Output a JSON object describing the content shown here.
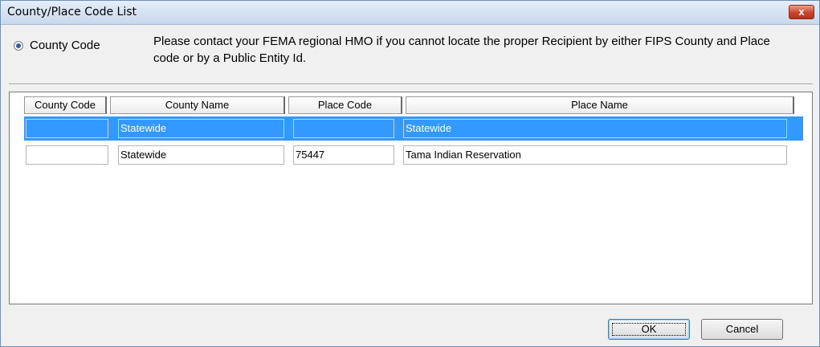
{
  "window": {
    "title": "County/Place Code List",
    "close_label": "x"
  },
  "radio": {
    "label": "County Code"
  },
  "message": "Please contact your FEMA regional HMO if you cannot locate the proper Recipient by either FIPS County and Place code or by a Public Entity Id.",
  "table": {
    "headers": [
      "County Code",
      "County Name",
      "Place Code",
      "Place Name"
    ],
    "rows": [
      {
        "county_code": "",
        "county_name": "Statewide",
        "place_code": "",
        "place_name": "Statewide",
        "selected": true
      },
      {
        "county_code": "",
        "county_name": "Statewide",
        "place_code": "75447",
        "place_name": "Tama Indian Reservation",
        "selected": false
      }
    ]
  },
  "buttons": {
    "ok": "OK",
    "cancel": "Cancel"
  },
  "colors": {
    "selection": "#3399ff",
    "titlebar": "#c8d8ec",
    "close": "#c8452b"
  }
}
